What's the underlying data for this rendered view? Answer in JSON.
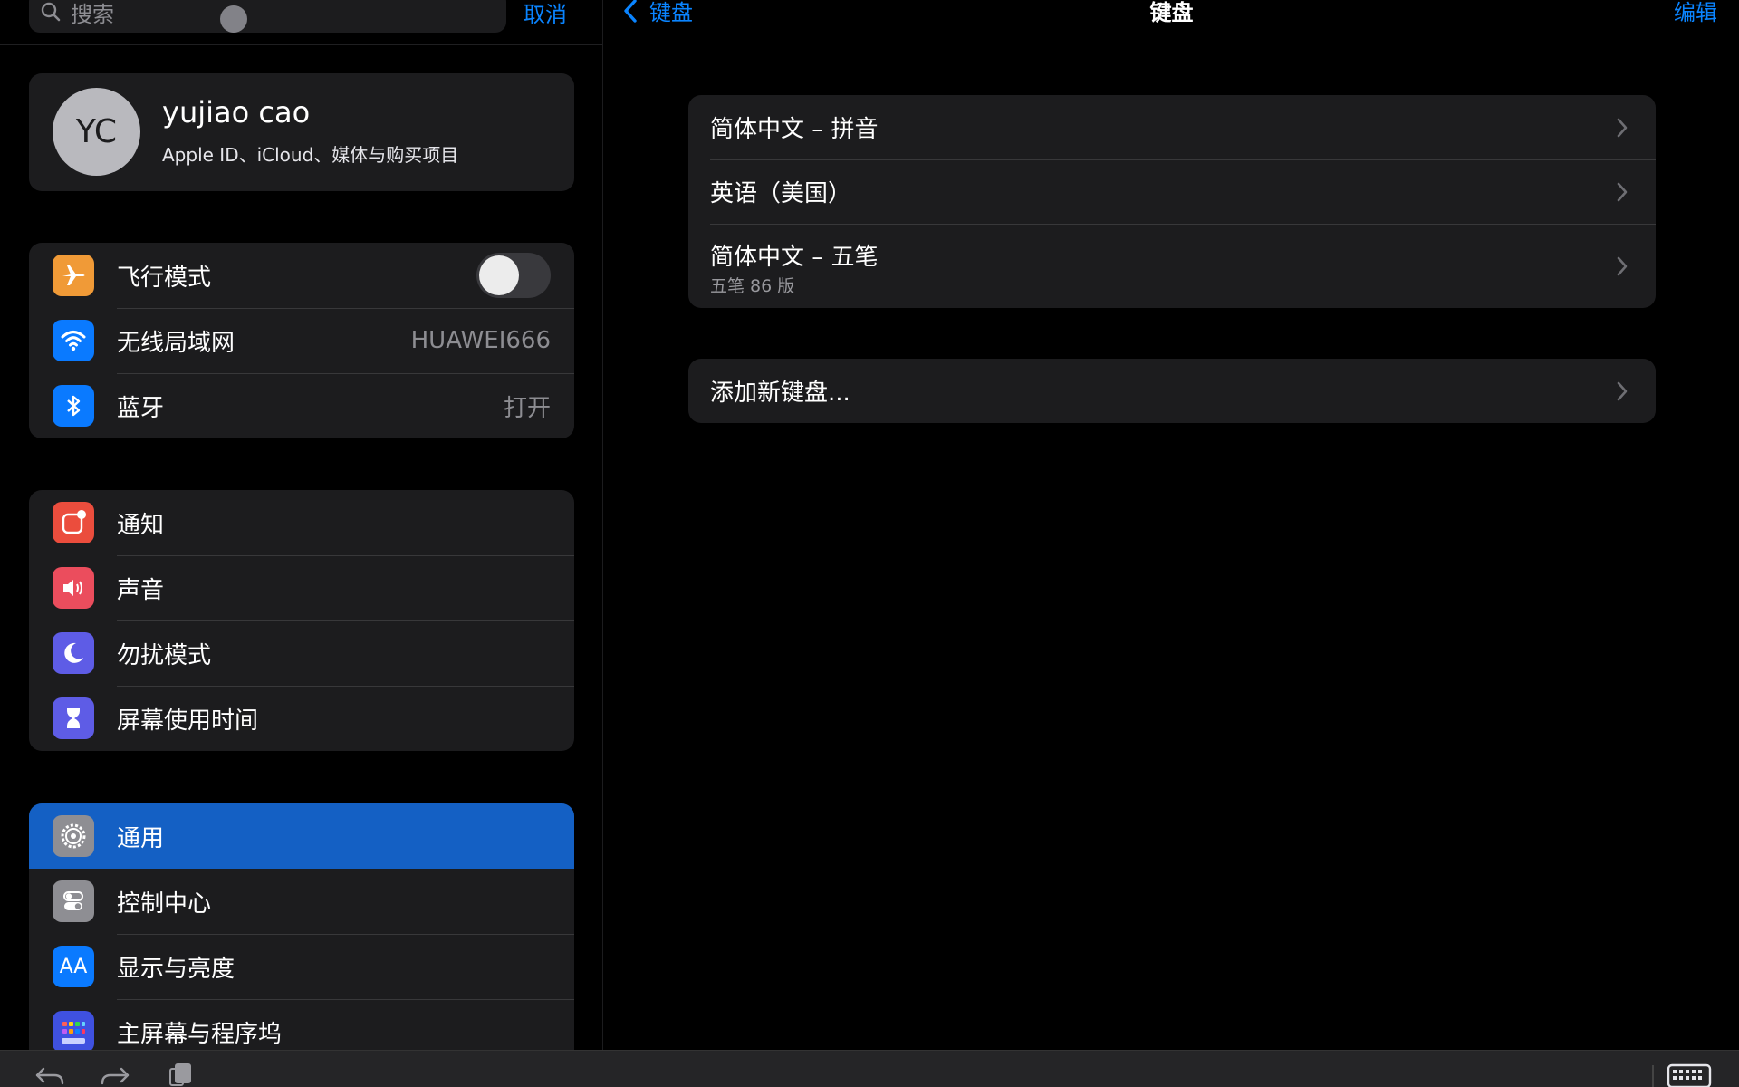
{
  "search": {
    "placeholder": "搜索",
    "cancel": "取消"
  },
  "profile": {
    "initials": "YC",
    "name": "yujiao cao",
    "subtitle": "Apple ID、iCloud、媒体与购买项目"
  },
  "connectivity": [
    {
      "label": "飞行模式",
      "icon": "airplane-icon",
      "color": "#f09a37",
      "toggle": false
    },
    {
      "label": "无线局域网",
      "icon": "wifi-icon",
      "color": "#0a7aff",
      "value": "HUAWEI666"
    },
    {
      "label": "蓝牙",
      "icon": "bluetooth-icon",
      "color": "#0a7aff",
      "value": "打开"
    }
  ],
  "alerts": [
    {
      "label": "通知",
      "icon": "notifications-icon",
      "color": "#eb4d3d"
    },
    {
      "label": "声音",
      "icon": "sound-icon",
      "color": "#eb4d5d"
    },
    {
      "label": "勿扰模式",
      "icon": "moon-icon",
      "color": "#5e5ce6"
    },
    {
      "label": "屏幕使用时间",
      "icon": "hourglass-icon",
      "color": "#5e5ce6"
    }
  ],
  "system": [
    {
      "label": "通用",
      "icon": "gear-icon",
      "color": "#8e8e93",
      "selected": true
    },
    {
      "label": "控制中心",
      "icon": "toggles-icon",
      "color": "#8e8e93"
    },
    {
      "label": "显示与亮度",
      "icon": "text-size-icon",
      "color": "#0a7aff",
      "icon_text": "AA"
    },
    {
      "label": "主屏幕与程序坞",
      "icon": "home-screen-icon",
      "color": "#3f51e0"
    }
  ],
  "detail": {
    "back_label": "键盘",
    "title": "键盘",
    "edit_label": "编辑",
    "keyboards": [
      {
        "label": "简体中文 – 拼音"
      },
      {
        "label": "英语（美国）"
      },
      {
        "label": "简体中文 – 五笔",
        "sub": "五笔 86 版"
      }
    ],
    "add_keyboard": "添加新键盘..."
  },
  "colors": {
    "accent": "#0a84ff",
    "selected_row": "#1460c4",
    "cell": "#1c1c1e"
  }
}
